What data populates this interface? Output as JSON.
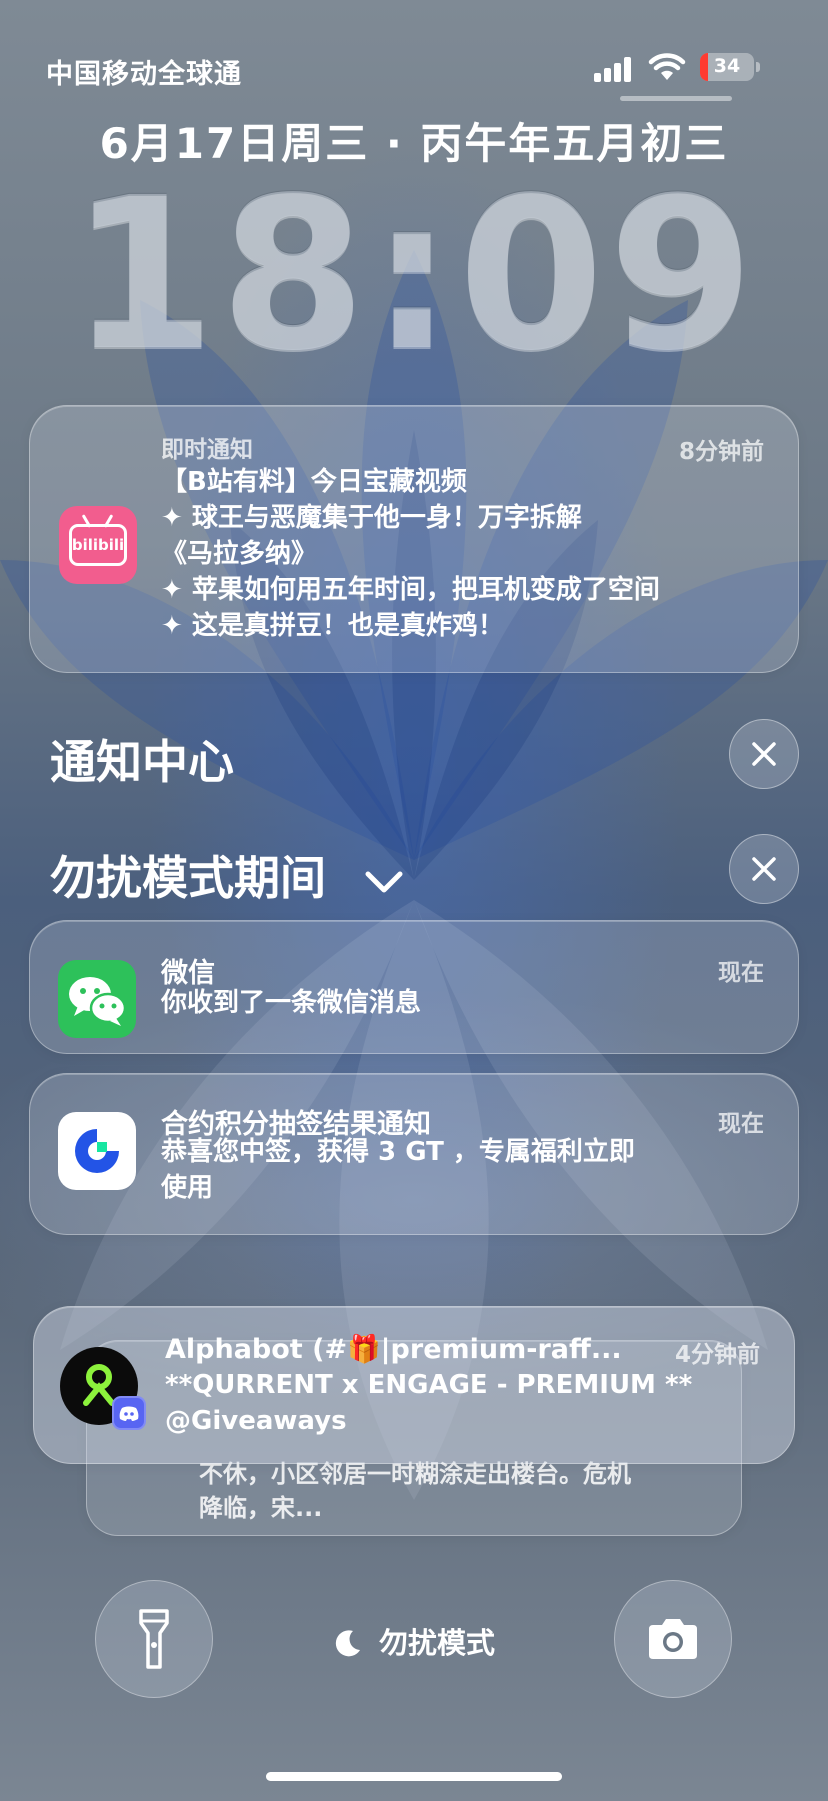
{
  "status_bar": {
    "carrier": "中国移动全球通",
    "battery_level": "34"
  },
  "lock_screen": {
    "date": "6月17日周三 · 丙午年五月初三",
    "time": "18:09"
  },
  "pinned_notification": {
    "app_icon": "bilibili-icon",
    "app_icon_text": "bilibili",
    "title": "即时通知",
    "time": "8分钟前",
    "lines": [
      "【B站有料】今日宝藏视频",
      "✦ 球王与恶魔集于他一身！万字拆解",
      "《马拉多纳》",
      "✦ 苹果如何用五年时间，把耳机变成了空间",
      "✦ 这是真拼豆！也是真炸鸡！"
    ]
  },
  "notification_center": {
    "title": "通知中心",
    "clear_icon": "close-icon"
  },
  "focus_group": {
    "title": "勿扰模式期间",
    "chevron_icon": "chevron-down-icon",
    "clear_icon": "close-icon"
  },
  "notifications": [
    {
      "app_icon": "wechat-icon",
      "title": "微信",
      "time": "现在",
      "body": "你收到了一条微信消息"
    },
    {
      "app_icon": "gate-icon",
      "title": "合约积分抽签结果通知",
      "time": "现在",
      "body_line1": "恭喜您中签，获得 3 GT ，专属福利立即",
      "body_line2": "使用"
    },
    {
      "app_icon": "discord-avatar-icon",
      "badge_icon": "discord-icon",
      "title": "Alphabot (#🎁|premium-raff...",
      "time": "4分钟前",
      "body_line1": "**QURRENT x ENGAGE - PREMIUM **",
      "body_line2": "@Giveaways"
    }
  ],
  "stacked_notification": {
    "line1": "不休，小区邻居一时糊涂走出楼台。危机",
    "line2": "降临，宋..."
  },
  "bottom_bar": {
    "flashlight_icon": "flashlight-icon",
    "camera_icon": "camera-icon",
    "focus_icon": "moon-icon",
    "focus_label": "勿扰模式"
  },
  "colors": {
    "bilibili": "#f25d8e",
    "wechat": "#2dc15a",
    "discord": "#5865f2",
    "gate_blue": "#2354e6",
    "gate_green": "#17e6a1",
    "battery_low": "#ff3b30"
  }
}
